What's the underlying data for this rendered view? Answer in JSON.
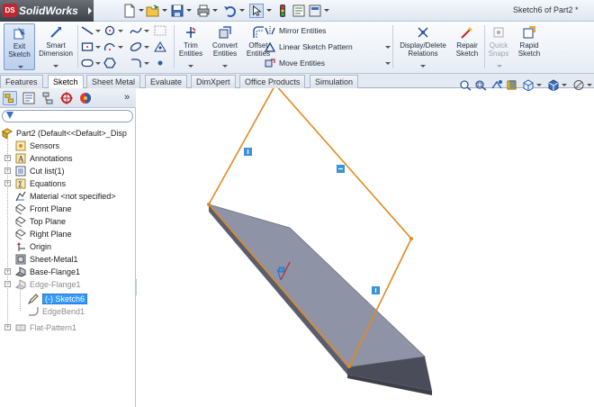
{
  "titlebar": {
    "logo_ds": "DS",
    "app_name": "SolidWorks",
    "document_title": "Sketch6 of Part2 *"
  },
  "command_manager": {
    "exit_sketch": "Exit\nSketch",
    "smart_dimension": "Smart\nDimension",
    "trim_entities": "Trim\nEntities",
    "convert_entities": "Convert\nEntities",
    "offset_entities": "Offset\nEntities",
    "mirror_entities": "Mirror Entities",
    "linear_sketch_pattern": "Linear Sketch Pattern",
    "move_entities": "Move Entities",
    "display_delete_relations": "Display/Delete\nRelations",
    "repair_sketch": "Repair\nSketch",
    "quick_snaps": "Quick\nSnaps",
    "rapid_sketch": "Rapid\nSketch"
  },
  "tabs": [
    "Features",
    "Sketch",
    "Sheet Metal",
    "Evaluate",
    "DimXpert",
    "Office Products",
    "Simulation"
  ],
  "active_tab": "Sketch",
  "feature_tree": {
    "root": "Part2  (Default<<Default>_Disp",
    "items": [
      {
        "label": "Sensors",
        "state": "normal"
      },
      {
        "label": "Annotations",
        "state": "normal"
      },
      {
        "label": "Cut list(1)",
        "state": "normal"
      },
      {
        "label": "Equations",
        "state": "normal"
      },
      {
        "label": "Material <not specified>",
        "state": "normal"
      },
      {
        "label": "Front Plane",
        "state": "normal"
      },
      {
        "label": "Top Plane",
        "state": "normal"
      },
      {
        "label": "Right Plane",
        "state": "normal"
      },
      {
        "label": "Origin",
        "state": "normal"
      },
      {
        "label": "Sheet-Metal1",
        "state": "normal"
      },
      {
        "label": "Base-Flange1",
        "state": "normal"
      },
      {
        "label": "Edge-Flange1",
        "state": "suppressed"
      },
      {
        "label": "(-) Sketch6",
        "state": "selected"
      },
      {
        "label": "EdgeBend1",
        "state": "suppressed"
      },
      {
        "label": "Flat-Pattern1",
        "state": "suppressed"
      }
    ]
  },
  "colors": {
    "sketch_line": "#e08a1e",
    "sheet_face": "#8e93a6",
    "sheet_edge": "#4a4d59",
    "relation_glyph": "#3a93d8",
    "selection": "#3399ff"
  }
}
